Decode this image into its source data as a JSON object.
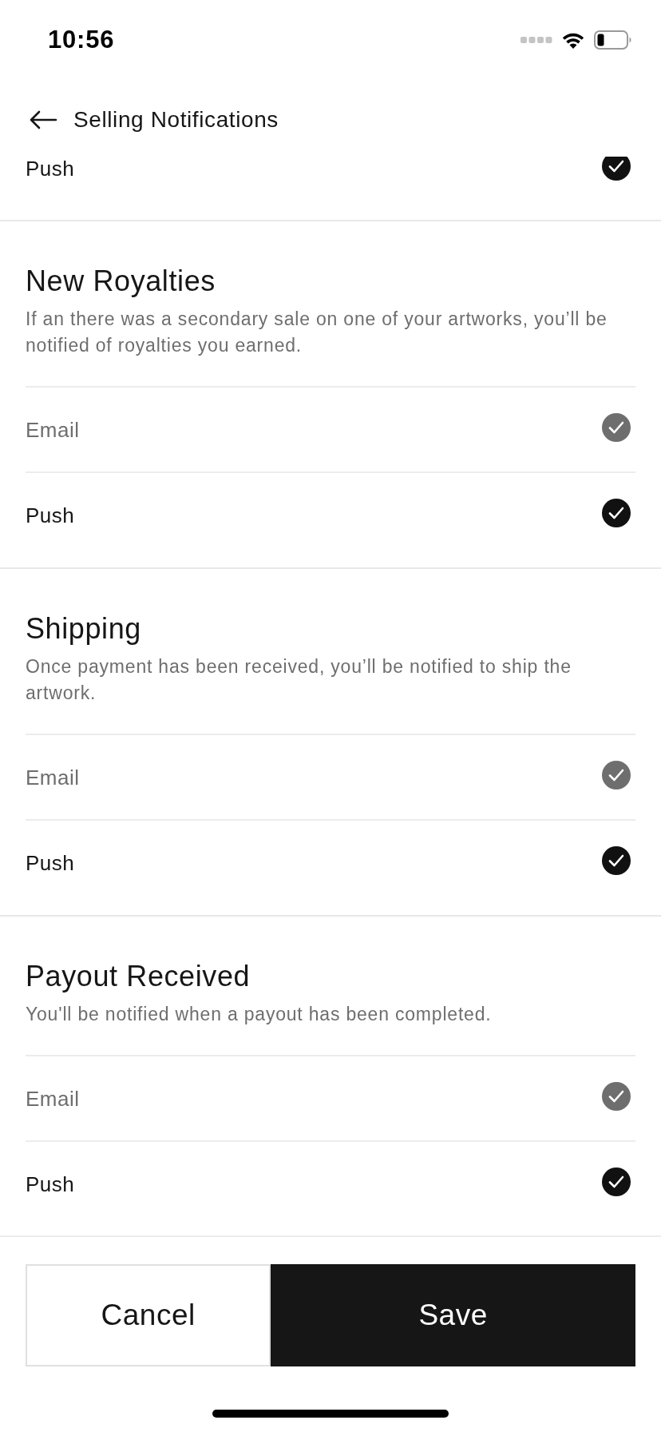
{
  "status_bar": {
    "time": "10:56"
  },
  "header": {
    "title": "Selling Notifications"
  },
  "partial_row": {
    "label": "Push",
    "checked": true,
    "disabled": false
  },
  "sections": [
    {
      "title": "New Royalties",
      "description": "If an there was a secondary sale on one of your artworks, you’ll be notified of royalties you earned.",
      "channels": [
        {
          "label": "Email",
          "checked": true,
          "disabled": true
        },
        {
          "label": "Push",
          "checked": true,
          "disabled": false
        }
      ]
    },
    {
      "title": "Shipping",
      "description": "Once payment has been received, you’ll be notified to ship the artwork.",
      "channels": [
        {
          "label": "Email",
          "checked": true,
          "disabled": true
        },
        {
          "label": "Push",
          "checked": true,
          "disabled": false
        }
      ]
    },
    {
      "title": "Payout Received",
      "description": "You'll be notified when a payout has been completed.",
      "channels": [
        {
          "label": "Email",
          "checked": true,
          "disabled": true
        },
        {
          "label": "Push",
          "checked": true,
          "disabled": false
        }
      ]
    }
  ],
  "buttons": [
    {
      "label": "Cancel",
      "kind": "secondary"
    },
    {
      "label": "Save",
      "kind": "primary"
    }
  ]
}
